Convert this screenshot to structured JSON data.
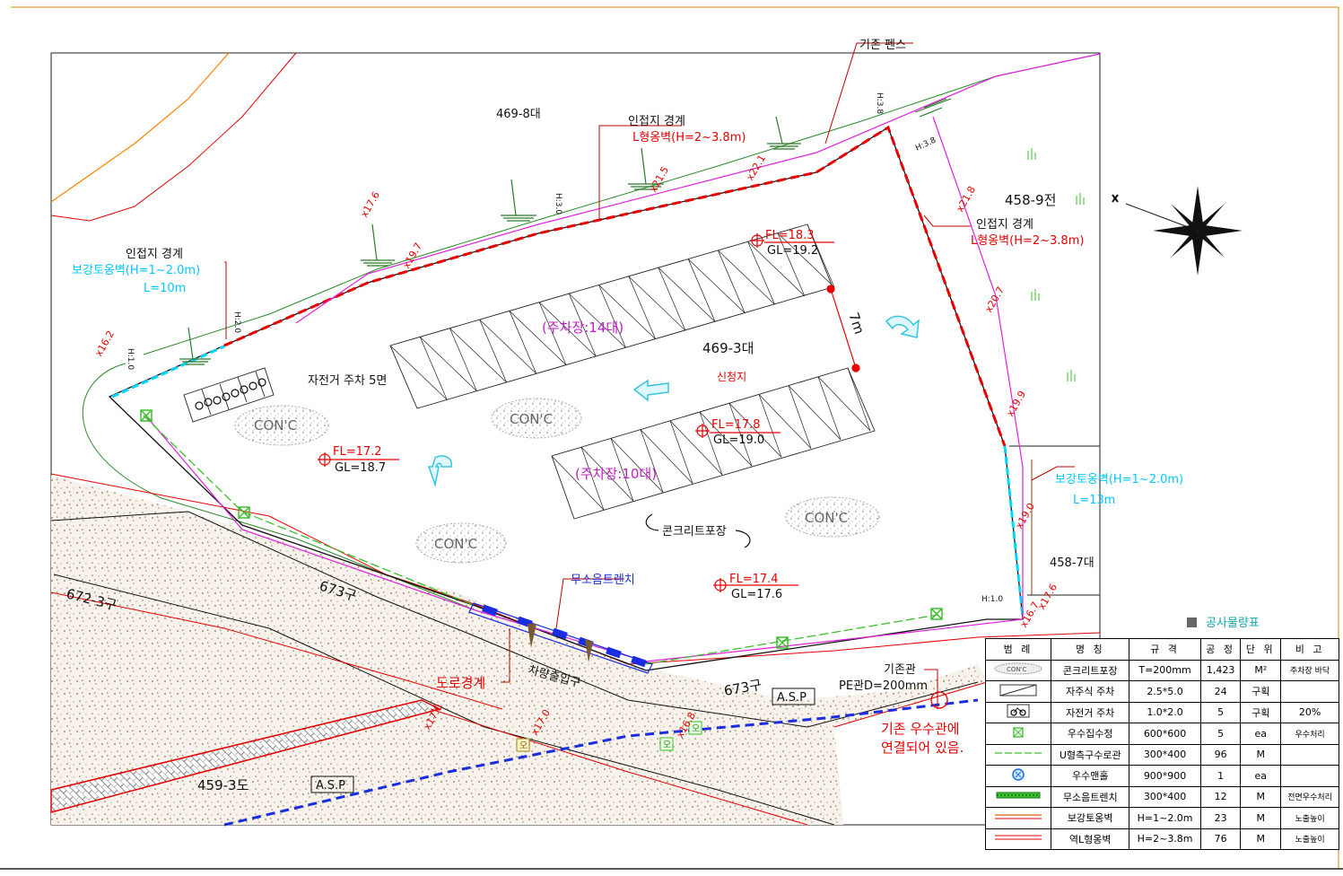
{
  "labels": {
    "existing_fence": "기존 펜스",
    "adj_boundary_1": "인접지 경계",
    "l_wall_top": "L형옹벽(H=2~3.8m)",
    "adj_boundary_2": "인접지 경계",
    "l_wall_right": "L형옹벽(H=2~3.8m)",
    "adj_boundary_3": "인접지 경계",
    "reinforce_wall_left": "보강토옹벽(H=1~2.0m)",
    "reinforce_wall_left_len": "L=10m",
    "reinforce_wall_right": "보강토옹벽(H=1~2.0m)",
    "reinforce_wall_right_len": "L=13m",
    "bike_parking": "자전거 주차 5면",
    "parking_14": "(주차장:14대)",
    "parking_10": "(주차장:10대)",
    "parcel_main": "469-3대",
    "applied_site": "신청지",
    "dim_7m": "7m",
    "concrete_pave": "콘크리트포장",
    "noiseless_trench": "무소음트렌치",
    "road_boundary": "도로경계",
    "vehicle_entrance": "차량출입구",
    "existing_pipe": "기존관",
    "existing_pipe_spec": "PE관D=200mm",
    "storm_connect_1": "기존 우수관에",
    "storm_connect_2": "연결되어 있음.",
    "asp": "A.S.P",
    "con_c": "CON'C",
    "h_30": "H:3.0",
    "h_20": "H:2.0",
    "h_10": "H:1.0",
    "h_38_a": "H:3.8",
    "h_38_b": "H:3.8",
    "h_10_b": "H:1.0"
  },
  "parcels": {
    "p469_8": "469-8대",
    "p458_9": "458-9전",
    "p458_7": "458-7대",
    "p672_3": "672-3구",
    "p673_a": "673구",
    "p673_b": "673구",
    "p459_3": "459-3도"
  },
  "levels": {
    "l1_fl": "FL=18.3",
    "l1_gl": "GL=19.2",
    "l2_fl": "FL=17.8",
    "l2_gl": "GL=19.0",
    "l3_fl": "FL=17.2",
    "l3_gl": "GL=18.7",
    "l4_fl": "FL=17.4",
    "l4_gl": "GL=17.6"
  },
  "spot_heights": [
    "x17.6",
    "x19.7",
    "x21.5",
    "x22.1",
    "x21.8",
    "x20.7",
    "x19.9",
    "x19.0",
    "x17.6",
    "x16.7",
    "x16.2",
    "x17.0",
    "x17.0",
    "x16.8"
  ],
  "manhole_label": "오",
  "quantity_table": {
    "title": "공사물량표",
    "headers": [
      "범 례",
      "명 칭",
      "규 격",
      "공 정",
      "단 위",
      "비 고"
    ],
    "rows": [
      {
        "name": "콘크리트포장",
        "spec": "T=200mm",
        "qty": "1,423",
        "unit": "M²",
        "note": "주차장 바닥"
      },
      {
        "name": "자주식 주차",
        "spec": "2.5*5.0",
        "qty": "24",
        "unit": "구획",
        "note": ""
      },
      {
        "name": "자전거 주차",
        "spec": "1.0*2.0",
        "qty": "5",
        "unit": "구획",
        "note": "20%"
      },
      {
        "name": "우수집수정",
        "spec": "600*600",
        "qty": "5",
        "unit": "ea",
        "note": "우수처리"
      },
      {
        "name": "U형측구수로관",
        "spec": "300*400",
        "qty": "96",
        "unit": "M",
        "note": ""
      },
      {
        "name": "우수맨홀",
        "spec": "900*900",
        "qty": "1",
        "unit": "ea",
        "note": ""
      },
      {
        "name": "무소음트렌치",
        "spec": "300*400",
        "qty": "12",
        "unit": "M",
        "note": "전면우수처리"
      },
      {
        "name": "보강토옹벽",
        "spec": "H=1~2.0m",
        "qty": "23",
        "unit": "M",
        "note": "노출높이"
      },
      {
        "name": "역L형옹벽",
        "spec": "H=2~3.8m",
        "qty": "76",
        "unit": "M",
        "note": "노출높이"
      }
    ]
  },
  "colors": {
    "boundary_red": "#e60000",
    "wall_magenta": "#e020e0",
    "drain_green": "#3bbf2a",
    "reinforce_cyan": "#00d8ff",
    "road_blue": "#1a2ee0",
    "label_red": "#e60000",
    "label_magenta": "#c020c0",
    "parcel_orange": "#ff8000"
  }
}
